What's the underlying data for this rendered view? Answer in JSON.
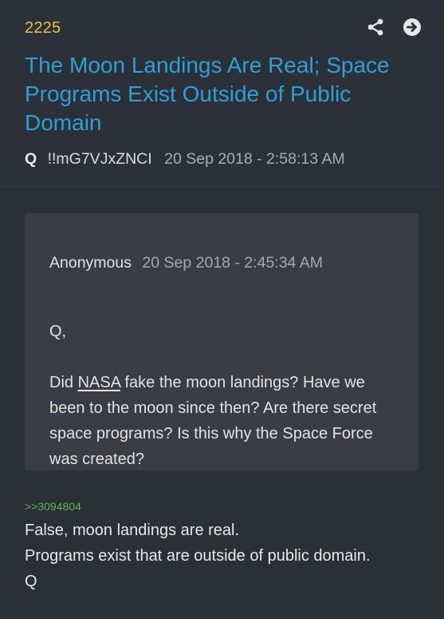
{
  "post": {
    "number": "2225",
    "title": "The Moon Landings Are Real; Space Programs Exist Outside of Public Domain",
    "author": "Q",
    "tripcode": "!!mG7VJxZNCI",
    "date": "20 Sep 2018 - 2:58:13 AM",
    "icons": {
      "share": "share-icon",
      "next": "arrow-right-circle-icon"
    }
  },
  "quote": {
    "author": "Anonymous",
    "date": "20 Sep 2018 - 2:45:34 AM",
    "greeting": "Q,",
    "text_before_link": "Did ",
    "link_text": "NASA",
    "text_after_link": " fake the moon landings?  Have we been to the moon since then?  Are there secret space programs?  Is this why the Space Force was created?"
  },
  "reply": {
    "ref_link": ">>3094804",
    "lines": [
      "False, moon landings are real.",
      "Programs exist that are outside of public domain.",
      "Q"
    ]
  },
  "colors": {
    "background": "#2d3037",
    "quote_box": "#3a3d44",
    "title": "#2f9fd6",
    "post_number": "#e3c54a",
    "reply_link": "#5fb84f",
    "muted_text": "#a9acb2"
  }
}
